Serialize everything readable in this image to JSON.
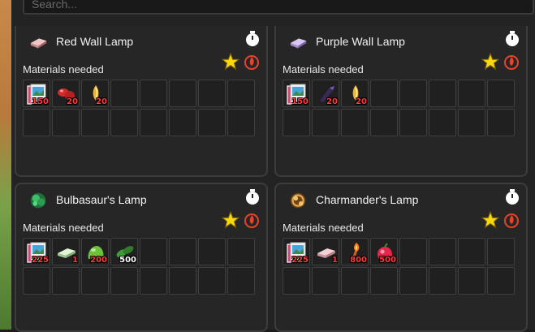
{
  "search": {
    "placeholder": "Search..."
  },
  "recipes": [
    {
      "title": "Red Wall Lamp",
      "icon": "red-wall-lamp-icon",
      "materials_label": "Materials needed",
      "materials": [
        {
          "icon": "photo-cards-icon",
          "qty": "150",
          "color": "red"
        },
        {
          "icon": "red-apricorn-icon",
          "qty": "20",
          "color": "red"
        },
        {
          "icon": "tiny-mushroom-icon",
          "qty": "20",
          "color": "red"
        }
      ]
    },
    {
      "title": "Purple Wall Lamp",
      "icon": "purple-wall-lamp-icon",
      "materials_label": "Materials needed",
      "materials": [
        {
          "icon": "photo-cards-icon",
          "qty": "150",
          "color": "red"
        },
        {
          "icon": "purple-shard-icon",
          "qty": "20",
          "color": "red"
        },
        {
          "icon": "tiny-mushroom-icon",
          "qty": "20",
          "color": "red"
        }
      ]
    },
    {
      "title": "Bulbasaur's Lamp",
      "icon": "bulbasaur-lamp-icon",
      "materials_label": "Materials needed",
      "materials": [
        {
          "icon": "photo-cards-icon",
          "qty": "225",
          "color": "red"
        },
        {
          "icon": "green-plank-icon",
          "qty": "1",
          "color": "red"
        },
        {
          "icon": "green-slime-icon",
          "qty": "200",
          "color": "red"
        },
        {
          "icon": "leaf-icon",
          "qty": "500",
          "color": "white"
        }
      ]
    },
    {
      "title": "Charmander's Lamp",
      "icon": "charmander-lamp-icon",
      "materials_label": "Materials needed",
      "materials": [
        {
          "icon": "photo-cards-icon",
          "qty": "225",
          "color": "red"
        },
        {
          "icon": "pink-plank-icon",
          "qty": "1",
          "color": "red"
        },
        {
          "icon": "fire-wand-icon",
          "qty": "800",
          "color": "red"
        },
        {
          "icon": "red-berry-icon",
          "qty": "500",
          "color": "red"
        }
      ]
    }
  ]
}
